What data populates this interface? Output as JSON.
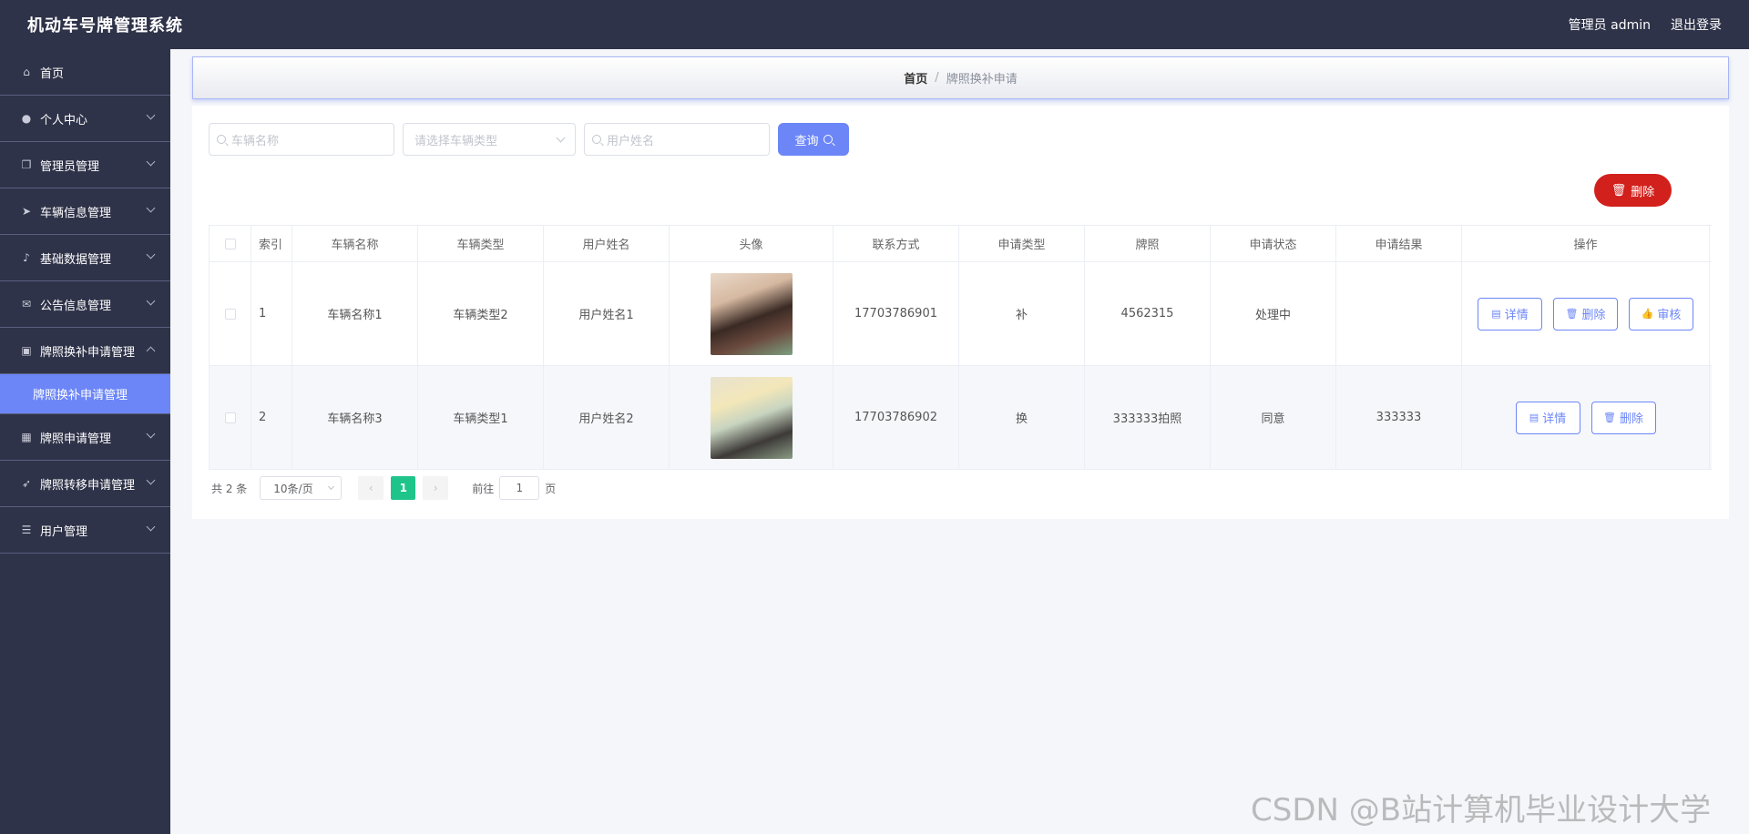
{
  "header": {
    "title": "机动车号牌管理系统",
    "user_label": "管理员 admin",
    "logout": "退出登录"
  },
  "sidebar": {
    "items": [
      {
        "label": "首页",
        "icon": "home-icon"
      },
      {
        "label": "个人中心",
        "icon": "user-icon"
      },
      {
        "label": "管理员管理",
        "icon": "copy-icon"
      },
      {
        "label": "车辆信息管理",
        "icon": "send-icon"
      },
      {
        "label": "基础数据管理",
        "icon": "microphone-icon"
      },
      {
        "label": "公告信息管理",
        "icon": "message-icon"
      },
      {
        "label": "牌照换补申请管理",
        "icon": "picture-icon"
      },
      {
        "label": "牌照申请管理",
        "icon": "grid-icon"
      },
      {
        "label": "牌照转移申请管理",
        "icon": "position-icon"
      },
      {
        "label": "用户管理",
        "icon": "list-icon"
      }
    ],
    "sub_active": "牌照换补申请管理"
  },
  "breadcrumb": {
    "home": "首页",
    "separator": "/",
    "current": "牌照换补申请"
  },
  "search": {
    "vehicle_name_placeholder": "车辆名称",
    "vehicle_type_placeholder": "请选择车辆类型",
    "user_name_placeholder": "用户姓名",
    "query_label": "查询"
  },
  "toolbar": {
    "delete_label": "删除"
  },
  "table": {
    "headers": [
      "索引",
      "车辆名称",
      "车辆类型",
      "用户姓名",
      "头像",
      "联系方式",
      "申请类型",
      "牌照",
      "申请状态",
      "申请结果",
      "操作"
    ],
    "rows": [
      {
        "index": "1",
        "vehicle_name": "车辆名称1",
        "vehicle_type": "车辆类型2",
        "user_name": "用户姓名1",
        "phone": "17703786901",
        "apply_type": "补",
        "plate": "4562315",
        "status": "处理中",
        "result": "",
        "actions": [
          "详情",
          "删除",
          "审核"
        ]
      },
      {
        "index": "2",
        "vehicle_name": "车辆名称3",
        "vehicle_type": "车辆类型1",
        "user_name": "用户姓名2",
        "phone": "17703786902",
        "apply_type": "换",
        "plate": "333333拍照",
        "status": "同意",
        "result": "333333",
        "actions": [
          "详情",
          "删除"
        ]
      }
    ]
  },
  "pagination": {
    "total": "共 2 条",
    "page_size": "10条/页",
    "current_page": "1",
    "goto_label": "前往",
    "goto_value": "1",
    "page_unit": "页",
    "prev": "‹",
    "next": "›"
  },
  "watermark": "CSDN @B站计算机毕业设计大学",
  "colors": {
    "header_bg": "#2f3349",
    "accent": "#6c86f8",
    "danger": "#d2201c",
    "pager_active": "#1fc48a"
  }
}
